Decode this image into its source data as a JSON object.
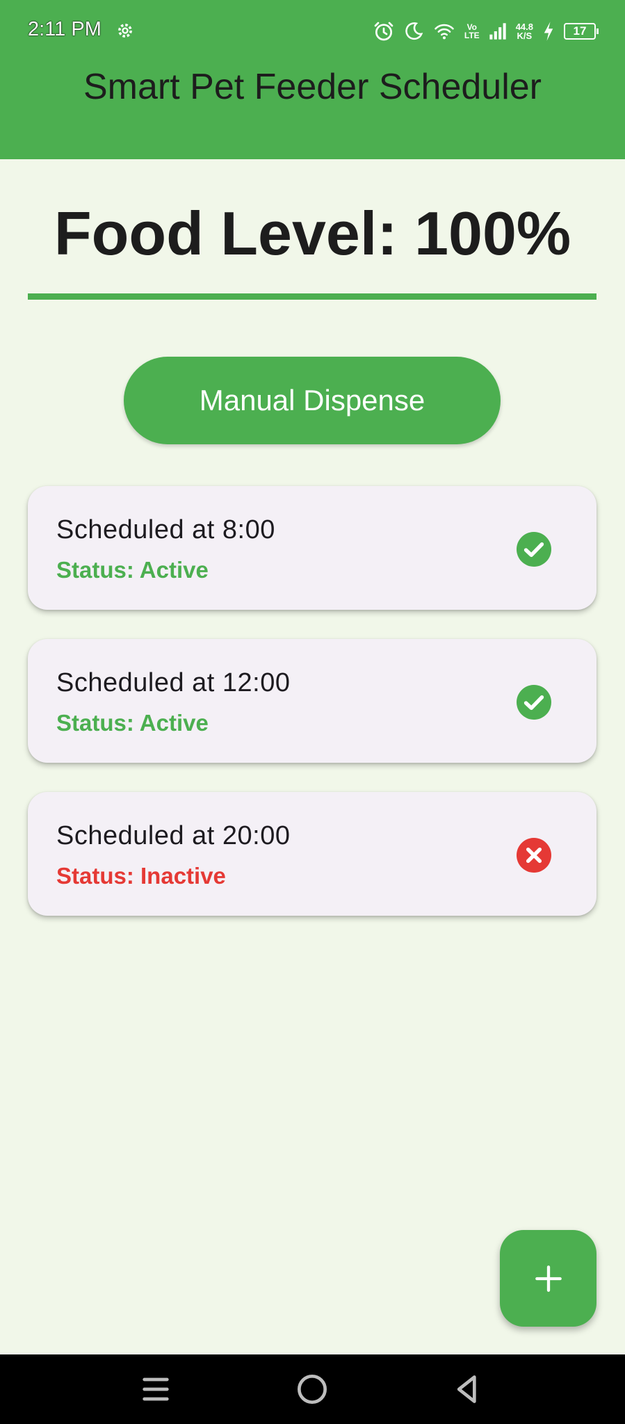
{
  "status_bar": {
    "time": "2:11 PM",
    "network_speed": "44.8",
    "network_speed_unit": "K/S",
    "network_type_top": "Vo",
    "network_type_bottom": "LTE",
    "battery": "17"
  },
  "app_bar": {
    "title": "Smart Pet Feeder Scheduler"
  },
  "food": {
    "label": "Food Level: 100%",
    "level_percent": 100
  },
  "manual_dispense": {
    "label": "Manual Dispense"
  },
  "schedules": [
    {
      "label": "Scheduled at 8:00",
      "status": "Status: Active",
      "active": true,
      "status_color": "#4caf50",
      "icon": "check-circle-icon"
    },
    {
      "label": "Scheduled at 12:00",
      "status": "Status: Active",
      "active": true,
      "status_color": "#4caf50",
      "icon": "check-circle-icon"
    },
    {
      "label": "Scheduled at 20:00",
      "status": "Status: Inactive",
      "active": false,
      "status_color": "#e53935",
      "icon": "cancel-circle-icon"
    }
  ],
  "fab": {
    "icon": "plus-icon"
  },
  "colors": {
    "primary": "#4caf50",
    "background": "#f1f7e9",
    "card": "#f4f0f6",
    "inactive": "#e53935"
  }
}
